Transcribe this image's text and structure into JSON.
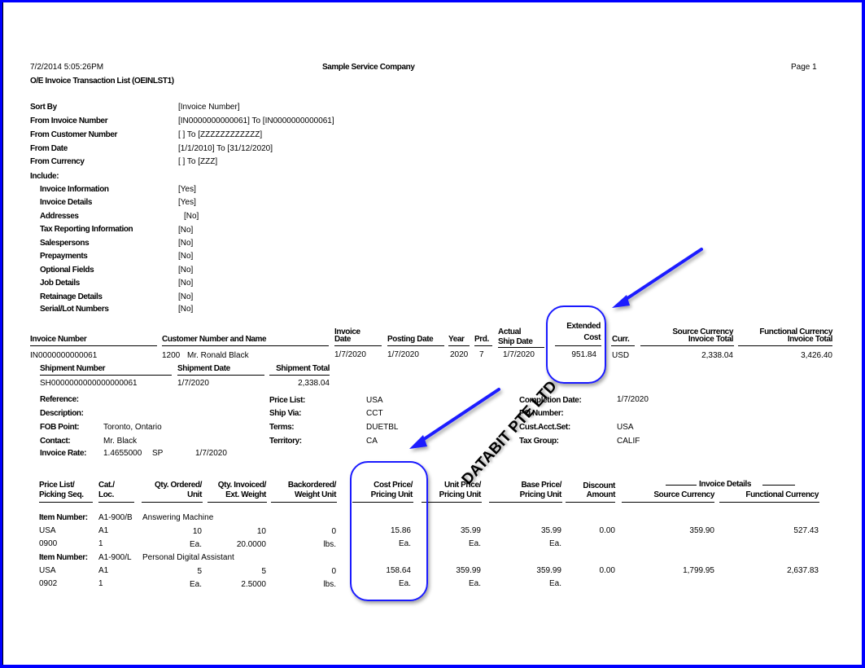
{
  "report": {
    "datetime": "7/2/2014   5:05:26PM",
    "company": "Sample Service Company",
    "page": "Page 1",
    "title": "O/E Invoice Transaction List (OEINLST1)"
  },
  "criteria": [
    {
      "label": "Sort By",
      "value": "[Invoice Number]"
    },
    {
      "label": "From Invoice Number",
      "value": "[IN0000000000061]  To  [IN0000000000061]"
    },
    {
      "label": "From Customer Number",
      "value": "[ ]  To  [ZZZZZZZZZZZZ]"
    },
    {
      "label": "From Date",
      "value": "[1/1/2010]  To  [31/12/2020]"
    },
    {
      "label": "From Currency",
      "value": "[ ]  To  [ZZZ]"
    }
  ],
  "include": {
    "label": "Include:",
    "items": [
      {
        "label": "Invoice Information",
        "value": "[Yes]"
      },
      {
        "label": "Invoice Details",
        "value": "[Yes]"
      },
      {
        "label": "Addresses",
        "value": "[No]"
      },
      {
        "label": "Tax Reporting Information",
        "value": "[No]"
      },
      {
        "label": "Salespersons",
        "value": "[No]"
      },
      {
        "label": "Prepayments",
        "value": "[No]"
      },
      {
        "label": "Optional Fields",
        "value": "[No]"
      },
      {
        "label": "Job Details",
        "value": "[No]"
      },
      {
        "label": "Retainage Details",
        "value": "[No]"
      },
      {
        "label": "Serial/Lot Numbers",
        "value": "[No]"
      }
    ]
  },
  "invoice_header": {
    "columns": {
      "invoice_number": "Invoice Number",
      "customer": "Customer Number and Name",
      "invoice_date_1": "Invoice",
      "invoice_date_2": "Date",
      "posting_date": "Posting Date",
      "year": "Year",
      "prd": "Prd.",
      "ship_date_1": "Actual",
      "ship_date_2": "Ship Date",
      "ext_cost_1": "Extended",
      "ext_cost_2": "Cost",
      "curr": "Curr.",
      "src_total_1": "Source Currency",
      "src_total_2": "Invoice Total",
      "func_total_1": "Functional Currency",
      "func_total_2": "Invoice Total"
    },
    "row": {
      "invoice_number": "IN0000000000061",
      "customer_number": "1200",
      "customer_name": "Mr. Ronald Black",
      "invoice_date": "1/7/2020",
      "posting_date": "1/7/2020",
      "year": "2020",
      "prd": "7",
      "ship_date": "1/7/2020",
      "ext_cost": "951.84",
      "curr": "USD",
      "src_total": "2,338.04",
      "func_total": "3,426.40"
    }
  },
  "shipment": {
    "columns": {
      "number": "Shipment Number",
      "date": "Shipment Date",
      "total": "Shipment Total"
    },
    "row": {
      "number": "SH0000000000000000061",
      "date": "1/7/2020",
      "total": "2,338.04"
    }
  },
  "details_left": [
    {
      "label": "Reference:",
      "value": ""
    },
    {
      "label": "Description:",
      "value": ""
    },
    {
      "label": "FOB Point:",
      "value": "Toronto, Ontario"
    },
    {
      "label": "Contact:",
      "value": "Mr. Black"
    }
  ],
  "invoice_rate": {
    "label": "Invoice Rate:",
    "rate": "1.4655000",
    "type": "SP",
    "date": "1/7/2020"
  },
  "details_mid": [
    {
      "label": "Price List:",
      "value": "USA"
    },
    {
      "label": "Ship Via:",
      "value": "CCT"
    },
    {
      "label": "Terms:",
      "value": "DUETBL"
    },
    {
      "label": "Territory:",
      "value": "CA"
    }
  ],
  "details_right": [
    {
      "label": "Completion Date:",
      "value": "1/7/2020"
    },
    {
      "label": "PO Number:",
      "value": ""
    },
    {
      "label": "Cust.Acct.Set:",
      "value": "USA"
    },
    {
      "label": "Tax Group:",
      "value": "CALIF"
    }
  ],
  "lines_header": {
    "price_list_1": "Price List/",
    "price_list_2": "Picking Seq.",
    "cat_1": "Cat./",
    "cat_2": "Loc.",
    "qty_ord_1": "Qty. Ordered/",
    "qty_ord_2": "Unit",
    "qty_inv_1": "Qty. Invoiced/",
    "qty_inv_2": "Ext. Weight",
    "backord_1": "Backordered/",
    "backord_2": "Weight Unit",
    "cost_1": "Cost Price/",
    "cost_2": "Pricing Unit",
    "unit_1": "Unit Price/",
    "unit_2": "Pricing Unit",
    "base_1": "Base Price/",
    "base_2": "Pricing Unit",
    "disc_1": "Discount",
    "disc_2": "Amount",
    "group": "Invoice Details",
    "src": "Source Currency",
    "func": "Functional Currency"
  },
  "items": [
    {
      "item_label": "Item Number:",
      "item_number": "A1-900/B",
      "description": "Answering Machine",
      "price_list": "USA",
      "cat": "A1",
      "qty_ordered": "10",
      "qty_invoiced": "10",
      "backordered": "0",
      "cost_price": "15.86",
      "unit_price": "35.99",
      "base_price": "35.99",
      "discount": "0.00",
      "source": "359.90",
      "functional": "527.43",
      "picking_seq": "0900",
      "loc": "1",
      "unit": "Ea.",
      "ext_weight": "20.0000",
      "weight_unit": "lbs.",
      "cost_unit": "Ea.",
      "unit_price_unit": "Ea.",
      "base_unit": "Ea."
    },
    {
      "item_label": "Item Number:",
      "item_number": "A1-900/L",
      "description": "Personal Digital Assistant",
      "price_list": "USA",
      "cat": "A1",
      "qty_ordered": "5",
      "qty_invoiced": "5",
      "backordered": "0",
      "cost_price": "158.64",
      "unit_price": "359.99",
      "base_price": "359.99",
      "discount": "0.00",
      "source": "1,799.95",
      "functional": "2,637.83",
      "picking_seq": "0902",
      "loc": "1",
      "unit": "Ea.",
      "ext_weight": "2.5000",
      "weight_unit": "lbs.",
      "cost_unit": "Ea.",
      "unit_price_unit": "Ea.",
      "base_unit": "Ea."
    }
  ],
  "watermark": "DATABIT PTE LTD",
  "colors": {
    "annotation": "#1a1aff",
    "frame": "#0000ff"
  }
}
